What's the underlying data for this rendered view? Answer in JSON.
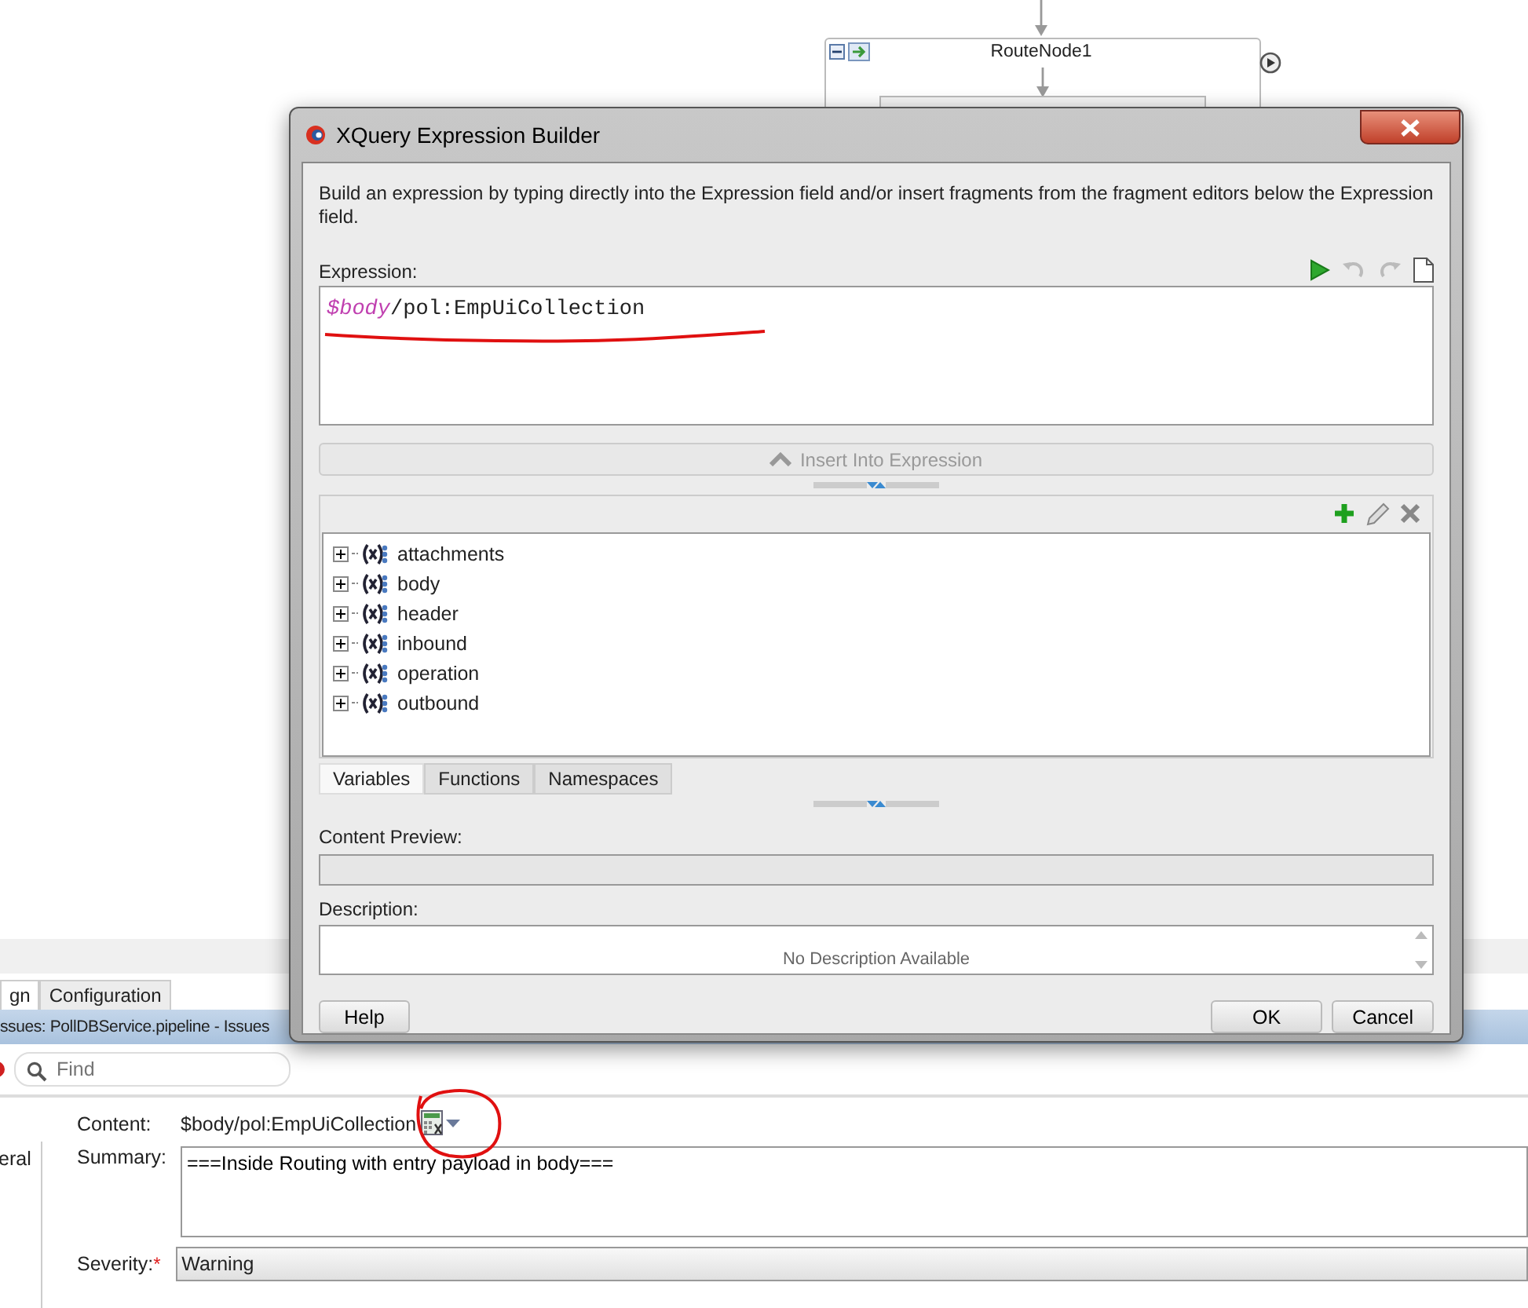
{
  "canvas": {
    "route_node": {
      "title": "RouteNode1"
    }
  },
  "editor_tabs": [
    {
      "label": "gn",
      "selected": true
    },
    {
      "label": "Configuration",
      "selected": false
    }
  ],
  "issues_bar": {
    "title": "ssues: PollDBService.pipeline - Issues"
  },
  "find": {
    "placeholder": "Find"
  },
  "sidebar": {
    "items": [
      {
        "label": "eral"
      }
    ]
  },
  "form": {
    "content": {
      "label": "Content:",
      "value": "$body/pol:EmpUiCollection"
    },
    "summary": {
      "label": "Summary:",
      "value": "===Inside Routing with entry payload in body==="
    },
    "severity": {
      "label": "Severity:",
      "required_mark": "*",
      "value": "Warning"
    }
  },
  "dialog": {
    "title": "XQuery Expression Builder",
    "intro": "Build an expression by typing directly into the Expression field and/or insert fragments from the fragment editors below the Expression field.",
    "expression": {
      "label": "Expression:",
      "variable": "$body",
      "path": "/pol:EmpUiCollection"
    },
    "insert_button": {
      "label": "Insert Into Expression",
      "disabled": true
    },
    "variables": [
      {
        "label": "attachments",
        "expanded": false
      },
      {
        "label": "body",
        "expanded": false
      },
      {
        "label": "header",
        "expanded": false
      },
      {
        "label": "inbound",
        "expanded": false
      },
      {
        "label": "operation",
        "expanded": false
      },
      {
        "label": "outbound",
        "expanded": false
      }
    ],
    "tabs": [
      {
        "label": "Variables",
        "selected": true
      },
      {
        "label": "Functions",
        "selected": false
      },
      {
        "label": "Namespaces",
        "selected": false
      }
    ],
    "content_preview": {
      "label": "Content Preview:"
    },
    "description": {
      "label": "Description:",
      "text": "No Description Available"
    },
    "buttons": {
      "help": "Help",
      "ok": "OK",
      "cancel": "Cancel"
    }
  }
}
